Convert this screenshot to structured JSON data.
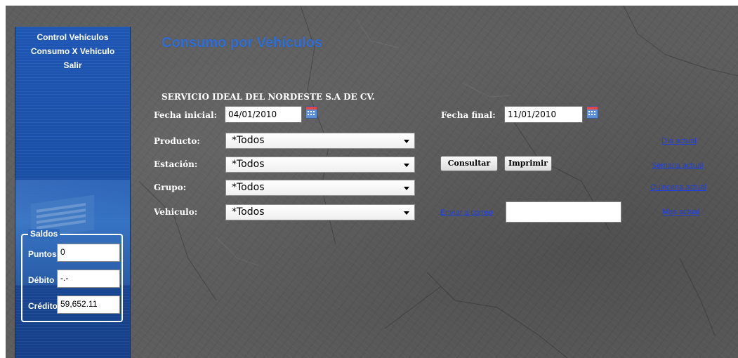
{
  "sidebar": {
    "menu": [
      "Control Vehículos",
      "Consumo X Vehículo",
      "Salir"
    ],
    "saldos": {
      "legend": "Saldos",
      "rows": [
        {
          "label": "Puntos",
          "value": "0"
        },
        {
          "label": "Débito",
          "value": "-.-"
        },
        {
          "label": "Crédito",
          "value": "59,652.11"
        }
      ]
    }
  },
  "main": {
    "title": "Consumo por Vehículos",
    "company": "SERVICIO IDEAL DEL NORDESTE S.A DE CV.",
    "fecha_inicial": {
      "label": "Fecha inicial:",
      "value": "04/01/2010"
    },
    "fecha_final": {
      "label": "Fecha final:",
      "value": "11/01/2010"
    },
    "filters": [
      {
        "label": "Producto:",
        "value": "*Todos"
      },
      {
        "label": "Estación:",
        "value": "*Todos"
      },
      {
        "label": "Grupo:",
        "value": "*Todos"
      },
      {
        "label": "Vehiculo:",
        "value": "*Todos"
      }
    ],
    "buttons": {
      "consultar": "Consultar",
      "imprimir": "Imprimir"
    },
    "email_link": "Enviar a correo",
    "email_value": "",
    "quick_links": [
      "Día actual",
      "Semana actual",
      "Quincena actual",
      "Mes actual"
    ],
    "icons": {
      "calendar": "calendar-icon"
    }
  }
}
